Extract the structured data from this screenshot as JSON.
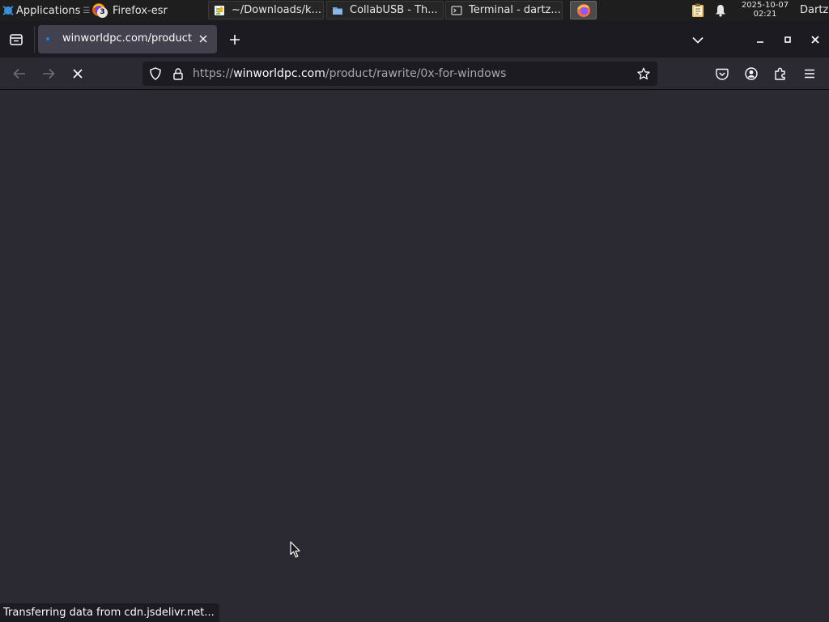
{
  "taskbar": {
    "applications_label": "Applications",
    "firefox_label": "Firefox-esr",
    "firefox_badge": "3",
    "tasks": [
      {
        "label": "~/Downloads/k...",
        "icon": "text-editor-icon"
      },
      {
        "label": "CollabUSB - Th...",
        "icon": "folder-icon"
      },
      {
        "label": "Terminal - dartz...",
        "icon": "terminal-icon"
      }
    ],
    "clock_date": "2025-10-07",
    "clock_time": "02:21",
    "user": "Dartz"
  },
  "browser": {
    "tab_title": "winworldpc.com/product",
    "url_prefix": "https://",
    "url_domain": "winworldpc.com",
    "url_path": "/product/rawrite/0x-for-windows",
    "status_text": "Transferring data from cdn.jsdelivr.net..."
  },
  "colors": {
    "accent": "#0a84ff",
    "toolbar": "#2b2a33",
    "tabstrip": "#1c1b22",
    "active_tab": "#42414d"
  }
}
